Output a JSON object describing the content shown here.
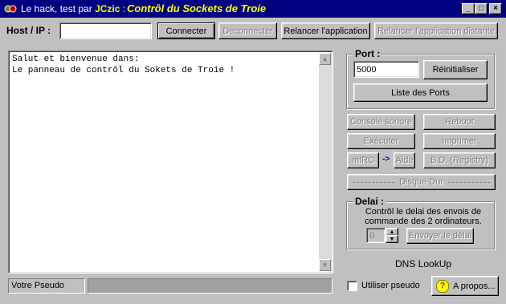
{
  "window": {
    "title_prefix": "Le hack, test par ",
    "title_author": "JCzic",
    "title_separator": " :",
    "title_main": "Contrôl du Sockets de Troie",
    "minimize": "_",
    "maximize": "□",
    "close": "×"
  },
  "toolbar": {
    "host_label": "Host / IP :",
    "host_value": "",
    "connect": "Connecter",
    "disconnect": "Deconnecter",
    "restart_app": "Relancer l'application",
    "restart_remote": "Relancer l'application distante"
  },
  "console": {
    "lines": "Salut et bienvenue dans:\nLe panneau de contrôl du Sokets de Troie !"
  },
  "status": {
    "pseudo_label": "Votre Pseudo",
    "pseudo_value": ""
  },
  "port": {
    "title": "Port :",
    "value": "5000",
    "reset": "Réinitialiser",
    "list": "Liste des Ports"
  },
  "actions": {
    "console_sonore": "Console sonore",
    "reboot": "Reboot",
    "executer": "Exécuter",
    "imprimer": "Imprimer",
    "mirc": "mIRC",
    "arrow": "->",
    "aide": "Aide",
    "registry": "B.D. (Registry)",
    "disque_dur": "Disque Dur"
  },
  "delai": {
    "title": "Delai :",
    "description": "Contrôl le delai des envois de commande des 2 ordinateurs.",
    "value": "0",
    "send": "Envoyer le délai"
  },
  "footer": {
    "dns": "DNS LookUp",
    "use_pseudo": "Utiliser pseudo",
    "about": "A propos..."
  },
  "colors": {
    "titlebar": "#000080",
    "title_highlight": "#ffff00",
    "face": "#c0c0c0"
  }
}
